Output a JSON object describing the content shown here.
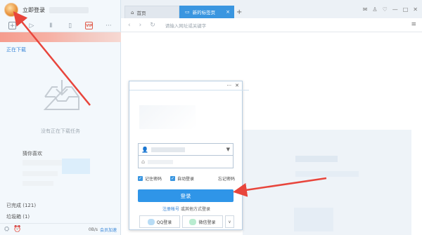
{
  "left_panel": {
    "login_label": "立即登录",
    "downloading_label": "正在下载",
    "empty_text": "没有正在下载任务",
    "guess_label": "猜你喜欢",
    "done_label": "已完成 (121)",
    "trash_label": "垃圾箱 (1)",
    "speed": "0B/s",
    "vip_speed": "会员加速",
    "toolbar_icons": [
      "add-icon",
      "play-icon",
      "pause-icon",
      "delete-icon",
      "vip-icon",
      "more-icon"
    ],
    "vip_icon_text": "VIP"
  },
  "browser": {
    "tabs": [
      {
        "label": "首页",
        "icon": "home-icon"
      },
      {
        "label": "新的标签页",
        "icon": "page-icon"
      }
    ],
    "add_tab": "+",
    "address_placeholder": "请输入网址或关键字",
    "window_controls": [
      "mail-icon",
      "shirt-icon",
      "heart-icon",
      "minimize-icon",
      "maximize-icon",
      "close-icon"
    ]
  },
  "login_popup": {
    "remember_password": "记住密码",
    "auto_login": "自动登录",
    "forgot_password": "忘记密码",
    "login_button": "登录",
    "register_link": "注册帐号",
    "other_login_text": "或其他方式登录",
    "qq_login": "QQ登录",
    "wechat_login": "微信登录",
    "colors": {
      "accent": "#2f95e8"
    }
  },
  "colors": {
    "accent": "#3a96e0",
    "annotation": "#e8453c"
  }
}
